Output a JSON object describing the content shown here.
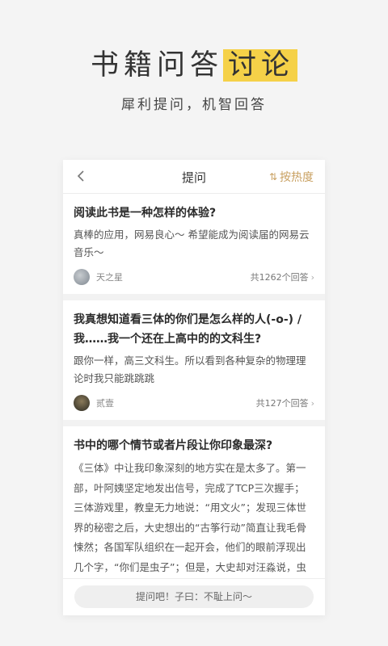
{
  "hero": {
    "title_main": "书籍问答",
    "title_highlight": "讨论",
    "subtitle": "犀利提问，机智回答"
  },
  "colors": {
    "highlight": "#f5d148",
    "accent": "#c9a162",
    "background": "#f4f4f4"
  },
  "topbar": {
    "title": "提问",
    "sort_icon": "⇅",
    "sort_label": "按热度",
    "back_icon": "chevron-left-icon"
  },
  "questions": [
    {
      "title": "阅读此书是一种怎样的体验?",
      "body": "真棒的应用，网易良心～ 希望能成为阅读届的网易云音乐～",
      "author": "天之星",
      "answers": "共1262个回答"
    },
    {
      "title": "我真想知道看三体的你们是怎么样的人(-o-) / 我……我一个还在上高中的的文科生?",
      "body": "跟你一样，高三文科生。所以看到各种复杂的物理理论时我只能跳跳跳",
      "author": "贰壹",
      "answers": "共127个回答"
    },
    {
      "title": "书中的哪个情节或者片段让你印象最深?",
      "body": "《三体》中让我印象深刻的地方实在是太多了。第一部，叶阿姨坚定地发出信号，完成了TCP三次握手；三体游戏里，教皇无力地说：“用文火”；发现三体世界的秘密之后，大史想出的“古筝行动”简直让我毛骨悚然；各国军队组织在一起开会，他们的眼前浮现出几个字，“你们是虫子”；但是，大史却对汪淼说，虫子从来没有被消灭过……第二部"
    }
  ],
  "chevron": "›",
  "bottom": {
    "ask_placeholder": "提问吧！子曰：不耻上问～"
  }
}
